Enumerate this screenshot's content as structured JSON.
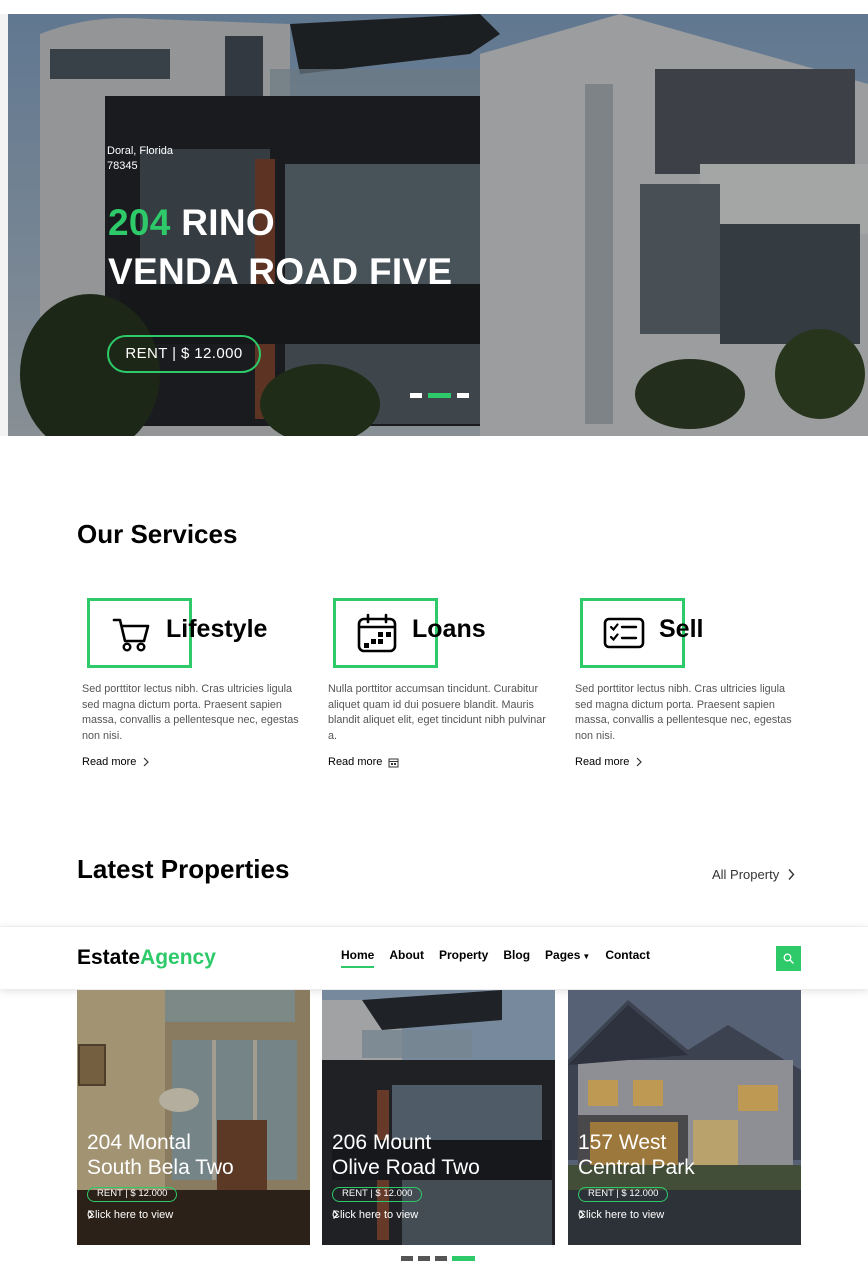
{
  "hero": {
    "location_line1": "Doral, Florida",
    "location_line2": "78345",
    "title_number": "204",
    "title_rest": " RINO",
    "title_line2": "VENDA ROAD FIVE",
    "price": "RENT | $ 12.000",
    "slides": 3,
    "active_slide": 2
  },
  "services": {
    "title": "Our Services",
    "items": [
      {
        "name": "Lifestyle",
        "icon": "cart-icon",
        "text": "Sed porttitor lectus nibh. Cras ultricies ligula sed magna dictum porta. Praesent sapien massa, convallis a pellentesque nec, egestas non nisi.",
        "link": "Read more",
        "link_icon": "chevron-right-icon"
      },
      {
        "name": "Loans",
        "icon": "calendar-icon",
        "text": "Nulla porttitor accumsan tincidunt. Curabitur aliquet quam id dui posuere blandit. Mauris blandit aliquet elit, eget tincidunt nibh pulvinar a.",
        "link": "Read more",
        "link_icon": "calendar-small-icon"
      },
      {
        "name": "Sell",
        "icon": "card-checklist-icon",
        "text": "Sed porttitor lectus nibh. Cras ultricies ligula sed magna dictum porta. Praesent sapien massa, convallis a pellentesque nec, egestas non nisi.",
        "link": "Read more",
        "link_icon": "chevron-right-icon"
      }
    ]
  },
  "latest": {
    "title": "Latest Properties",
    "all_link": "All Property"
  },
  "navbar": {
    "brand_part1": "Estate",
    "brand_part2": "Agency",
    "items": [
      "Home",
      "About",
      "Property",
      "Blog",
      "Pages",
      "Contact"
    ],
    "active": "Home",
    "search_icon": "search-icon"
  },
  "properties": [
    {
      "line1": "204 Montal",
      "line2": "South Bela Two",
      "price": "RENT | $ 12.000",
      "link": "Click here to view"
    },
    {
      "line1": "206 Mount",
      "line2": "Olive Road Two",
      "price": "RENT | $ 12.000",
      "link": "Click here to view"
    },
    {
      "line1": "157 West",
      "line2": "Central Park",
      "price": "RENT | $ 12.000",
      "link": "Click here to view"
    }
  ],
  "carousel": {
    "dots": 4,
    "active": 4
  },
  "colors": {
    "accent": "#2eca6a",
    "text": "#000000",
    "muted": "#555555"
  }
}
